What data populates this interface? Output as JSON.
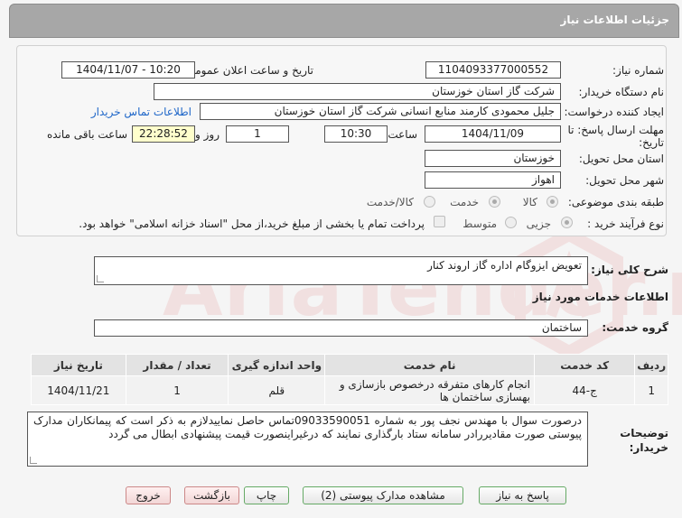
{
  "header": {
    "title": "جزئیات اطلاعات نیاز"
  },
  "fields": {
    "need_number_label": "شماره نیاز:",
    "need_number": "1104093377000552",
    "announce_label": "تاریخ و ساعت اعلان عمومی:",
    "announce_value": "1404/11/07 - 10:20",
    "buyer_org_label": "نام دستگاه خریدار:",
    "buyer_org": "شرکت گاز استان خوزستان",
    "creator_label": "ایجاد کننده درخواست:",
    "creator": "جلیل محمودی کارمند منابع انسانی شرکت گاز استان خوزستان",
    "contact_link": "اطلاعات تماس خریدار",
    "deadline_label_1": "مهلت ارسال پاسخ: تا",
    "deadline_label_2": "تاریخ:",
    "deadline_date": "1404/11/09",
    "time_label": "ساعت",
    "deadline_time": "10:30",
    "days_value": "1",
    "days_label": "روز و",
    "remaining_time": "22:28:52",
    "remaining_label": "ساعت باقی مانده",
    "province_label": "استان محل تحویل:",
    "province": "خوزستان",
    "city_label": "شهر محل تحویل:",
    "city": "اهواز",
    "category_label": "طبقه بندی موضوعی:",
    "category_options": [
      "کالا",
      "خدمت",
      "کالا/خدمت"
    ],
    "process_label": "نوع فرآیند خرید :",
    "process_options": [
      "جزیی",
      "متوسط"
    ],
    "treasury_note": "پرداخت تمام یا بخشی از مبلغ خرید،از محل \"اسناد خزانه اسلامی\" خواهد بود."
  },
  "summary": {
    "label": "شرح کلی نیاز:",
    "value": "تعویض ایزوگام اداره گاز اروند کنار"
  },
  "services_section": {
    "title": "اطلاعات خدمات مورد نیاز"
  },
  "service_group": {
    "label": "گروه خدمت:",
    "value": "ساختمان"
  },
  "table": {
    "headers": [
      "ردیف",
      "کد خدمت",
      "نام خدمت",
      "واحد اندازه گیری",
      "تعداد / مقدار",
      "تاریخ نیاز"
    ],
    "rows": [
      [
        "1",
        "ج-44",
        "انجام کارهای متفرقه درخصوص بازسازی و بهسازی ساختمان ها",
        "قلم",
        "1",
        "1404/11/21"
      ]
    ]
  },
  "buyer_notes": {
    "label_1": "توضیحات",
    "label_2": "خریدار:",
    "value": "درصورت سوال با مهندس نجف پور به شماره 09033590051تماس حاصل نمایید‌لازم به ذکر است که پیمانکاران مدارک پیوستی صورت مقادیررادر سامانه ستاد بارگذاری نمایند که درغیراینصورت قیمت پیشنهادی ابطال می گردد"
  },
  "buttons": {
    "reply": "پاسخ به نیاز",
    "attachments": "مشاهده مدارک پیوستی (2)",
    "print": "چاپ",
    "back": "بازگشت",
    "exit": "خروج"
  },
  "watermark": {
    "text": "AriaTender.neT"
  },
  "colors": {
    "titlebar": "#a7a7a7",
    "link": "#1e66c8",
    "remaining_bg": "#ffffcc"
  }
}
